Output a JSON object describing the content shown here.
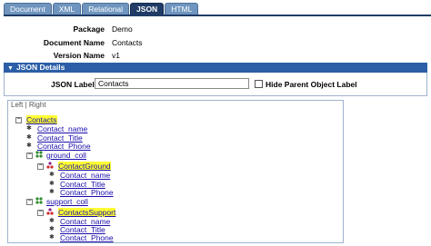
{
  "tabs": [
    "Document",
    "XML",
    "Relational",
    "JSON",
    "HTML"
  ],
  "active_tab": "JSON",
  "info": [
    {
      "label": "Package",
      "value": "Demo"
    },
    {
      "label": "Document Name",
      "value": "Contacts"
    },
    {
      "label": "Version Name",
      "value": "v1"
    }
  ],
  "json_details": {
    "header": "JSON Details",
    "json_label_label": "JSON Label",
    "json_label_value": "Contacts",
    "hide_parent_label": "Hide Parent Object Label",
    "hide_parent_checked": false
  },
  "tree": {
    "panel_title": "Left | Right",
    "nodes": [
      {
        "text": "Contacts",
        "kind": "object",
        "highlight": true
      },
      {
        "text": "Contact_name",
        "kind": "leaf"
      },
      {
        "text": "Contact_Title",
        "kind": "leaf"
      },
      {
        "text": "Contact_Phone",
        "kind": "leaf"
      },
      {
        "text": "ground_coll",
        "kind": "collection"
      },
      {
        "text": "ContactGround",
        "kind": "object",
        "highlight": true
      },
      {
        "text": "Contact_name",
        "kind": "leaf"
      },
      {
        "text": "Contact_Title",
        "kind": "leaf"
      },
      {
        "text": "Contact_Phone",
        "kind": "leaf"
      },
      {
        "text": "support_coll",
        "kind": "collection"
      },
      {
        "text": "ContactsSupport",
        "kind": "object",
        "highlight": true
      },
      {
        "text": "Contact_name",
        "kind": "leaf"
      },
      {
        "text": "Contact_Title",
        "kind": "leaf"
      },
      {
        "text": "Contact_Phone",
        "kind": "leaf"
      }
    ]
  },
  "colors": {
    "tab_active": "#1f3b66",
    "tab_inactive": "#6f95be",
    "section_header": "#2b5ea7",
    "highlight": "#ffff33",
    "link": "#1a0dab"
  },
  "icons": {
    "collapse": "minus-box-icon",
    "leaf": "gear-icon",
    "collection": "collection-icon",
    "object": "object-icon"
  }
}
